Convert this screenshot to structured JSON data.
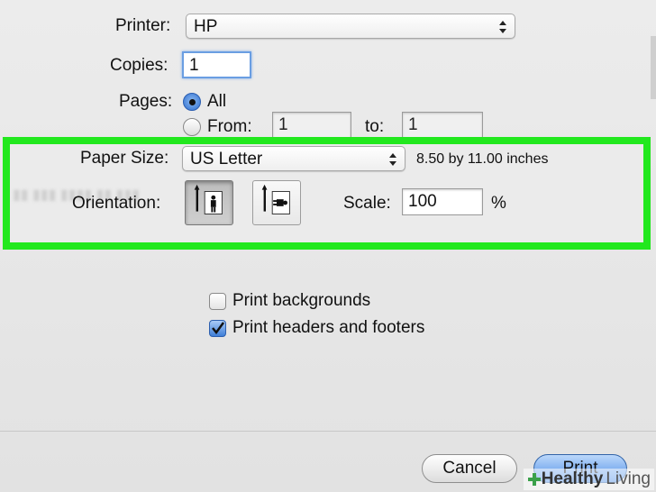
{
  "printer": {
    "label": "Printer:",
    "value": "HP"
  },
  "copies": {
    "label": "Copies:",
    "value": "1"
  },
  "pages": {
    "label": "Pages:",
    "all_label": "All",
    "from_label": "From:",
    "from_value": "1",
    "to_label": "to:",
    "to_value": "1",
    "selected": "All"
  },
  "paper_size": {
    "label": "Paper Size:",
    "value": "US Letter",
    "dimensions": "8.50 by 11.00 inches"
  },
  "orientation": {
    "label": "Orientation:",
    "selected": "portrait"
  },
  "scale": {
    "label": "Scale:",
    "value": "100",
    "unit": "%"
  },
  "options": {
    "print_backgrounds": {
      "label": "Print backgrounds",
      "checked": false
    },
    "print_headers_footers": {
      "label": "Print headers and footers",
      "checked": true
    }
  },
  "buttons": {
    "cancel": "Cancel",
    "print": "Print"
  },
  "watermark": {
    "brand": "Healthy",
    "suffix": "Living"
  },
  "colors": {
    "highlight": "#22e81e",
    "accent": "#3f7fd8"
  }
}
